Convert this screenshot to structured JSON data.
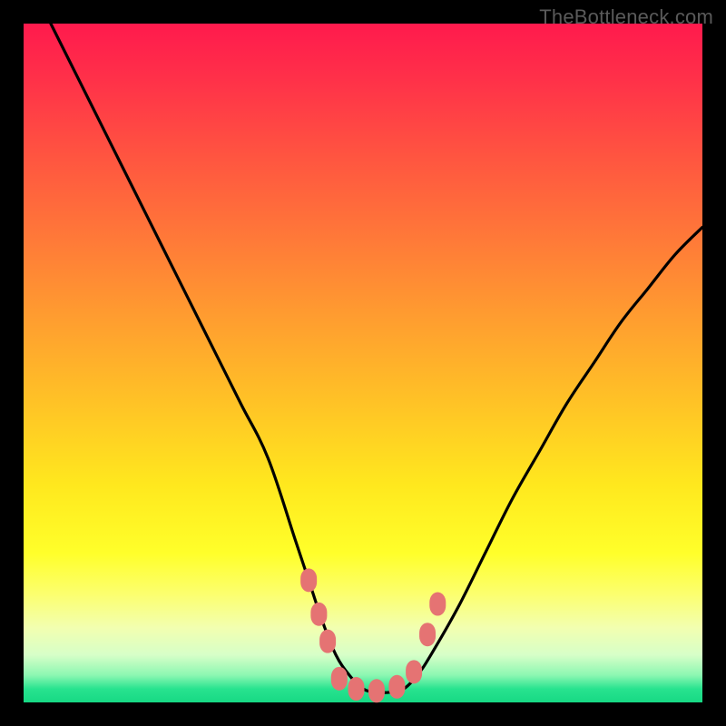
{
  "watermark": {
    "text": "TheBottleneck.com"
  },
  "colors": {
    "frame": "#000000",
    "curve_stroke": "#000000",
    "marker_fill": "#e57373",
    "gradient_stops": [
      "#ff1a4d",
      "#ff3049",
      "#ff5640",
      "#ff7a38",
      "#ff9f2f",
      "#ffc326",
      "#ffe81e",
      "#ffff2a",
      "#fcff6e",
      "#f2ffb0",
      "#d7ffc8",
      "#8cf7b2",
      "#28e38f",
      "#17d984"
    ]
  },
  "chart_data": {
    "type": "line",
    "title": "",
    "xlabel": "",
    "ylabel": "",
    "xlim": [
      0,
      100
    ],
    "ylim": [
      0,
      100
    ],
    "grid": false,
    "legend": false,
    "series": [
      {
        "name": "curve",
        "x": [
          4,
          8,
          12,
          16,
          20,
          24,
          28,
          32,
          36,
          40,
          42,
          44,
          46,
          48,
          50,
          52,
          54,
          56,
          58,
          60,
          64,
          68,
          72,
          76,
          80,
          84,
          88,
          92,
          96,
          100
        ],
        "y": [
          100,
          92,
          84,
          76,
          68,
          60,
          52,
          44,
          36,
          24,
          18,
          12,
          7,
          4,
          2,
          1.5,
          1.5,
          2,
          4,
          7,
          14,
          22,
          30,
          37,
          44,
          50,
          56,
          61,
          66,
          70
        ]
      }
    ],
    "markers": [
      {
        "x": 42.0,
        "y": 18.0
      },
      {
        "x": 43.5,
        "y": 13.0
      },
      {
        "x": 44.8,
        "y": 9.0
      },
      {
        "x": 46.5,
        "y": 3.5
      },
      {
        "x": 49.0,
        "y": 2.0
      },
      {
        "x": 52.0,
        "y": 1.7
      },
      {
        "x": 55.0,
        "y": 2.3
      },
      {
        "x": 57.5,
        "y": 4.5
      },
      {
        "x": 59.5,
        "y": 10.0
      },
      {
        "x": 61.0,
        "y": 14.5
      }
    ]
  }
}
